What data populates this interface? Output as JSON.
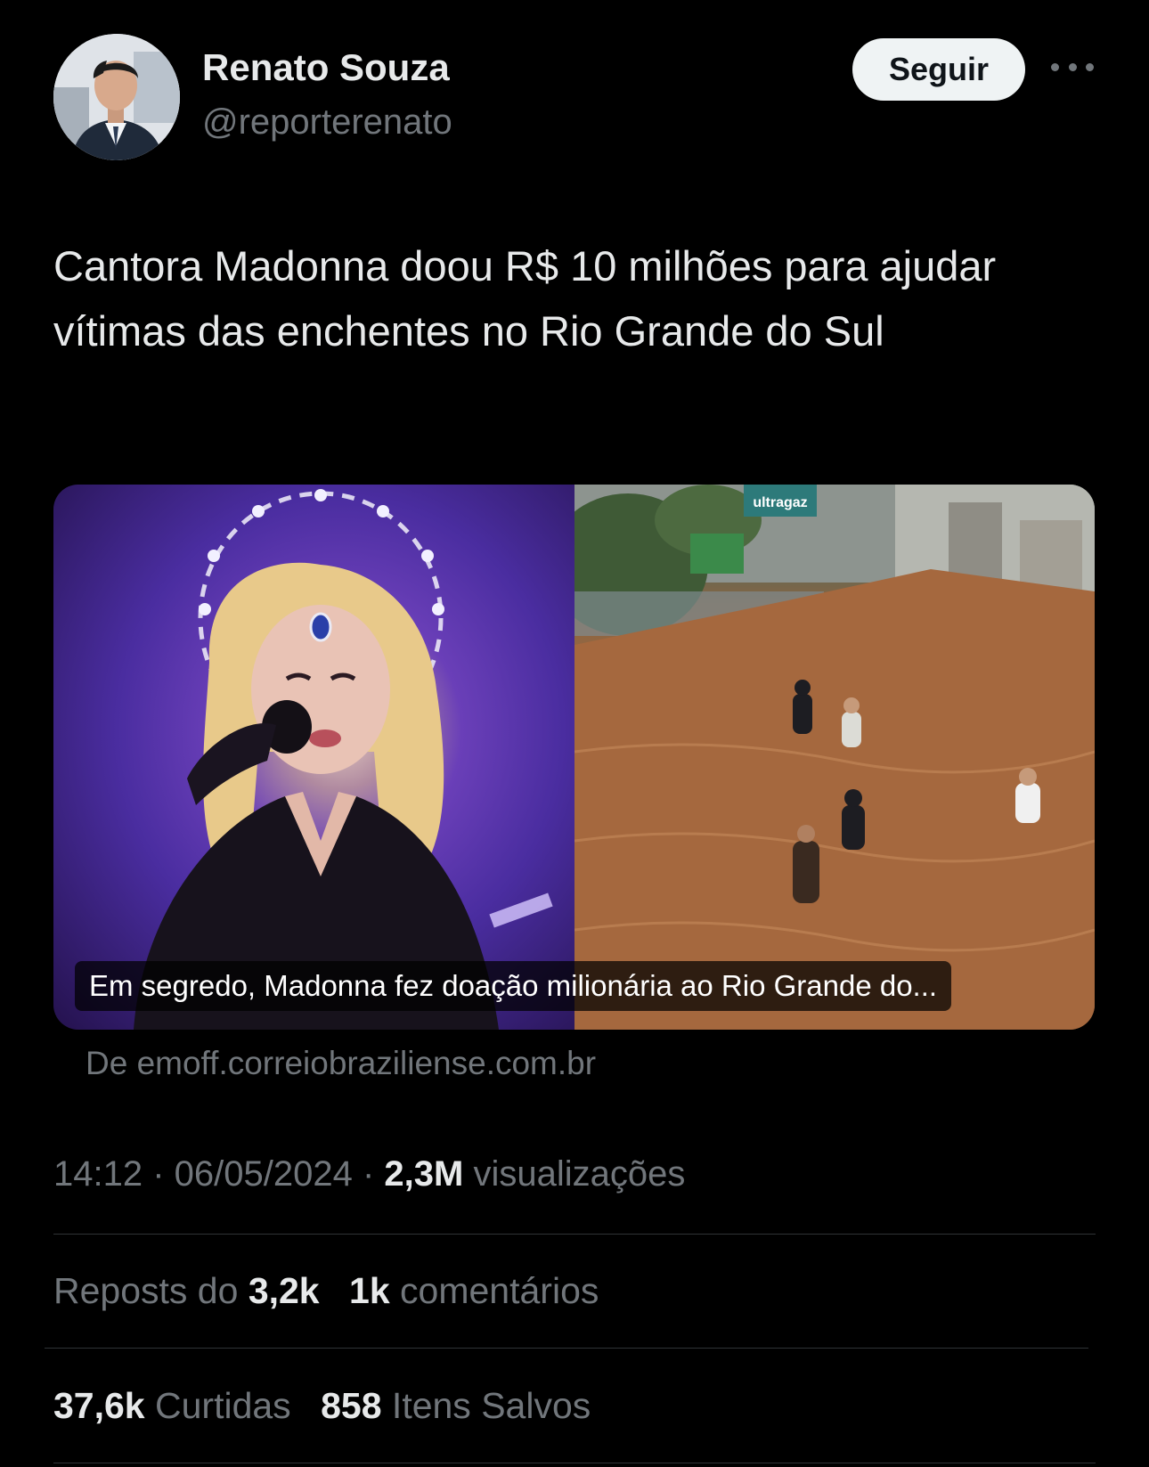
{
  "author": {
    "name": "Renato Souza",
    "handle": "@reporterenato",
    "follow_label": "Seguir"
  },
  "tweet": {
    "text": "Cantora Madonna doou R$ 10 milhões para ajudar vítimas das enchentes no Rio Grande do Sul"
  },
  "card": {
    "caption": "Em segredo, Madonna fez doação milionária ao Rio Grande do...",
    "source": "De emoff.correiobraziliense.com.br",
    "sign_text": "ultragaz"
  },
  "meta": {
    "time": "14:12",
    "separator": " · ",
    "date": "06/05/2024",
    "views_count": "2,3M",
    "views_label": "visualizações"
  },
  "stats": {
    "reposts_label": "Reposts do",
    "reposts_count": "3,2k",
    "comments_count": "1k",
    "comments_label": "comentários",
    "likes_count": "37,6k",
    "likes_label": "Curtidas",
    "saves_count": "858",
    "saves_label": "Itens Salvos"
  },
  "icons": {
    "more": "more-horizontal-icon",
    "avatar": "profile-photo"
  },
  "colors": {
    "background": "#000000",
    "primary_text": "#e7e9ea",
    "secondary_text": "#71767b",
    "follow_button_bg": "#eff3f4",
    "divider": "#2f3336"
  }
}
